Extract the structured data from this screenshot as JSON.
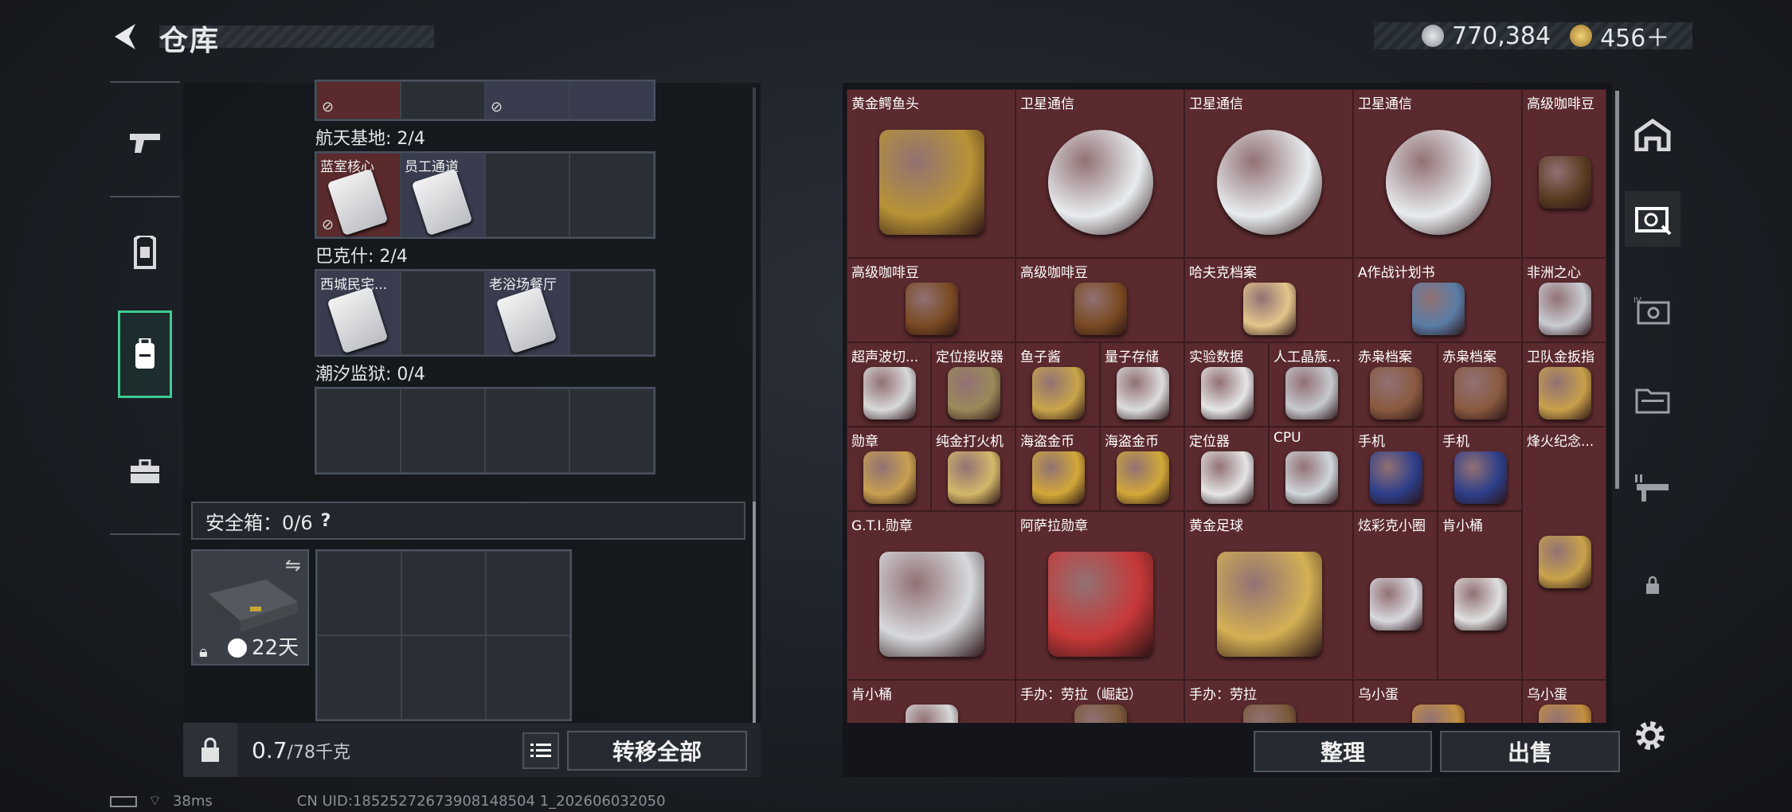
{
  "header": {
    "title": "仓库"
  },
  "currency": {
    "silver": "770,384",
    "gold": "456＋"
  },
  "left_nav": [
    "gun-icon",
    "vest-icon",
    "backpack-icon",
    "briefcase-icon"
  ],
  "left_panel": {
    "top_row": {
      "cells": [
        {
          "label": ""
        },
        {
          "label": ""
        },
        {
          "label": ""
        },
        {
          "label": ""
        }
      ]
    },
    "sections": [
      {
        "title": "航天基地: 2/4",
        "cells": [
          {
            "label": "蓝室核心",
            "color": "red"
          },
          {
            "label": "员工通道",
            "color": "blue"
          },
          {
            "label": ""
          },
          {
            "label": ""
          }
        ]
      },
      {
        "title": "巴克什: 2/4",
        "cells": [
          {
            "label": "西城民宅...",
            "color": "blue"
          },
          {
            "label": ""
          },
          {
            "label": "老浴场餐厅",
            "color": "blue"
          },
          {
            "label": ""
          }
        ]
      },
      {
        "title": "潮汐监狱: 0/4",
        "cells": [
          {
            "label": ""
          },
          {
            "label": ""
          },
          {
            "label": ""
          },
          {
            "label": ""
          }
        ]
      }
    ],
    "safe_box": {
      "label": "安全箱：0/6",
      "help": "?",
      "days": "22天"
    },
    "weight": {
      "value": "0.7",
      "max": "/78千克"
    },
    "transfer_button": "转移全部"
  },
  "items": [
    {
      "label": "黄金鳄鱼头",
      "color": "#b89336"
    },
    {
      "label": "卫星通信",
      "color": "#e8ecef"
    },
    {
      "label": "卫星通信",
      "color": "#e8ecef"
    },
    {
      "label": "卫星通信",
      "color": "#e8ecef"
    },
    {
      "label": "高级咖啡豆",
      "color": "#5a3c22"
    },
    {
      "label": "高级咖啡豆",
      "color": "#7a4a22"
    },
    {
      "label": "高级咖啡豆",
      "color": "#7a4a22"
    },
    {
      "label": "哈夫克档案",
      "color": "#e3c58b"
    },
    {
      "label": "A作战计划书",
      "color": "#5a7da6"
    },
    {
      "label": "非洲之心",
      "color": "#c9ccd3"
    },
    {
      "label": "超声波切...",
      "color": "#d8d8d8"
    },
    {
      "label": "定位接收器",
      "color": "#9a8a5a"
    },
    {
      "label": "鱼子酱",
      "color": "#c9a54a"
    },
    {
      "label": "量子存储",
      "color": "#dcdcdc"
    },
    {
      "label": "实验数据",
      "color": "#e6e6e6"
    },
    {
      "label": "人工晶簇...",
      "color": "#c6c9cf"
    },
    {
      "label": "赤枭档案",
      "color": "#8a5a40"
    },
    {
      "label": "赤枭档案",
      "color": "#8a5a40"
    },
    {
      "label": "卫队金扳指",
      "color": "#c7a04a"
    },
    {
      "label": "勋章",
      "color": "#c8a050"
    },
    {
      "label": "纯金打火机",
      "color": "#d4b86a"
    },
    {
      "label": "海盗金币",
      "color": "#d2a838"
    },
    {
      "label": "海盗金币",
      "color": "#d2a838"
    },
    {
      "label": "定位器",
      "color": "#e5e5e5"
    },
    {
      "label": "CPU",
      "color": "#cfd6dc"
    },
    {
      "label": "手机",
      "color": "#2d3e8a"
    },
    {
      "label": "手机",
      "color": "#2d3e8a"
    },
    {
      "label": "烽火纪念...",
      "color": "#c9a34a"
    },
    {
      "label": "G.T.I.勋章",
      "color": "#d6d9dd"
    },
    {
      "label": "阿萨拉勋章",
      "color": "#c73838"
    },
    {
      "label": "黄金足球",
      "color": "#d4b054"
    },
    {
      "label": "炫彩克小圈",
      "color": "#d9d9e0"
    },
    {
      "label": "肯小桶",
      "color": "#e0e0e0"
    },
    {
      "label": "肯小桶",
      "color": "#d8d8d8"
    },
    {
      "label": "手办：劳拉（崛起）",
      "color": "#7a5a3a"
    },
    {
      "label": "手办：劳拉",
      "color": "#7a5a3a"
    },
    {
      "label": "乌小蛋",
      "color": "#c49040"
    },
    {
      "label": "乌小蛋",
      "color": "#c49040"
    }
  ],
  "buttons": {
    "sort": "整理",
    "sell": "出售"
  },
  "right_nav": [
    "bunker-icon",
    "safe-icon",
    "safe-iv-icon",
    "folder-icon",
    "gun-rack-icon",
    "lock-icon"
  ],
  "status": {
    "ping": "38ms",
    "uid": "CN UID:18525272673908148504 1_202606032050"
  }
}
